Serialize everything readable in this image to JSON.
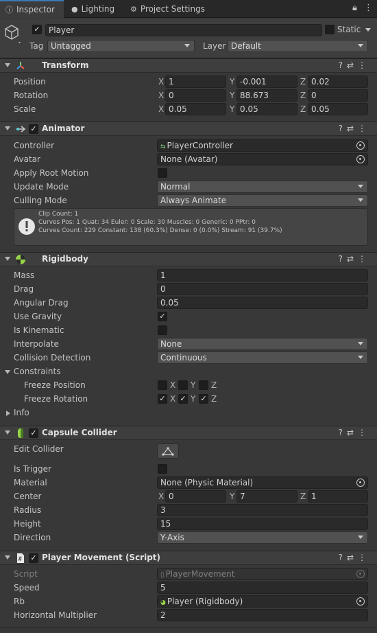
{
  "tabs": [
    {
      "label": "Inspector",
      "icon": "info-icon",
      "active": true
    },
    {
      "label": "Lighting",
      "icon": "bulb-icon",
      "active": false
    },
    {
      "label": "Project Settings",
      "icon": "gear-icon",
      "active": false
    }
  ],
  "tab_menu": {
    "lock": "lock-icon",
    "more": "more-icon"
  },
  "header": {
    "name": "Player",
    "active": true,
    "static_label": "Static",
    "static_checked": false,
    "tag_label": "Tag",
    "tag_value": "Untagged",
    "layer_label": "Layer",
    "layer_value": "Default"
  },
  "transform": {
    "title": "Transform",
    "position": {
      "label": "Position",
      "x": "1",
      "y": "-0.001",
      "z": "0.02"
    },
    "rotation": {
      "label": "Rotation",
      "x": "0",
      "y": "88.673",
      "z": "0"
    },
    "scale": {
      "label": "Scale",
      "x": "0.05",
      "y": "0.05",
      "z": "0.05"
    },
    "axes": {
      "x": "X",
      "y": "Y",
      "z": "Z"
    }
  },
  "animator": {
    "title": "Animator",
    "enabled": true,
    "controller": {
      "label": "Controller",
      "value": "PlayerController"
    },
    "avatar": {
      "label": "Avatar",
      "value": "None (Avatar)"
    },
    "apply_root_motion": {
      "label": "Apply Root Motion",
      "checked": false
    },
    "update_mode": {
      "label": "Update Mode",
      "value": "Normal"
    },
    "culling_mode": {
      "label": "Culling Mode",
      "value": "Always Animate"
    },
    "info": {
      "line1": "Clip Count: 1",
      "line2": "Curves Pos: 1 Quat: 34 Euler: 0 Scale: 30 Muscles: 0 Generic: 0 PPtr: 0",
      "line3": "Curves Count: 229 Constant: 138 (60.3%) Dense: 0 (0.0%) Stream: 91 (39.7%)"
    }
  },
  "rigidbody": {
    "title": "Rigidbody",
    "mass": {
      "label": "Mass",
      "value": "1"
    },
    "drag": {
      "label": "Drag",
      "value": "0"
    },
    "angular_drag": {
      "label": "Angular Drag",
      "value": "0.05"
    },
    "use_gravity": {
      "label": "Use Gravity",
      "checked": true
    },
    "is_kinematic": {
      "label": "Is Kinematic",
      "checked": false
    },
    "interpolate": {
      "label": "Interpolate",
      "value": "None"
    },
    "collision_detection": {
      "label": "Collision Detection",
      "value": "Continuous"
    },
    "constraints": {
      "label": "Constraints"
    },
    "freeze_position": {
      "label": "Freeze Position",
      "x": false,
      "y": false,
      "z": false
    },
    "freeze_rotation": {
      "label": "Freeze Rotation",
      "x": true,
      "y": true,
      "z": true
    },
    "info": {
      "label": "Info"
    }
  },
  "capsule": {
    "title": "Capsule Collider",
    "enabled": true,
    "edit_collider": {
      "label": "Edit Collider"
    },
    "is_trigger": {
      "label": "Is Trigger",
      "checked": false
    },
    "material": {
      "label": "Material",
      "value": "None (Physic Material)"
    },
    "center": {
      "label": "Center",
      "x": "0",
      "y": "7",
      "z": "1"
    },
    "radius": {
      "label": "Radius",
      "value": "3"
    },
    "height": {
      "label": "Height",
      "value": "15"
    },
    "direction": {
      "label": "Direction",
      "value": "Y-Axis"
    }
  },
  "script": {
    "title": "Player Movement (Script)",
    "enabled": true,
    "script": {
      "label": "Script",
      "value": "PlayerMovement"
    },
    "speed": {
      "label": "Speed",
      "value": "5"
    },
    "rb": {
      "label": "Rb",
      "value": "Player (Rigidbody)"
    },
    "horizontal_multiplier": {
      "label": "Horizontal Multiplier",
      "value": "2"
    }
  },
  "glyphs": {
    "check": "✓",
    "help": "?",
    "presets": "⇄",
    "menu": "⋮"
  }
}
